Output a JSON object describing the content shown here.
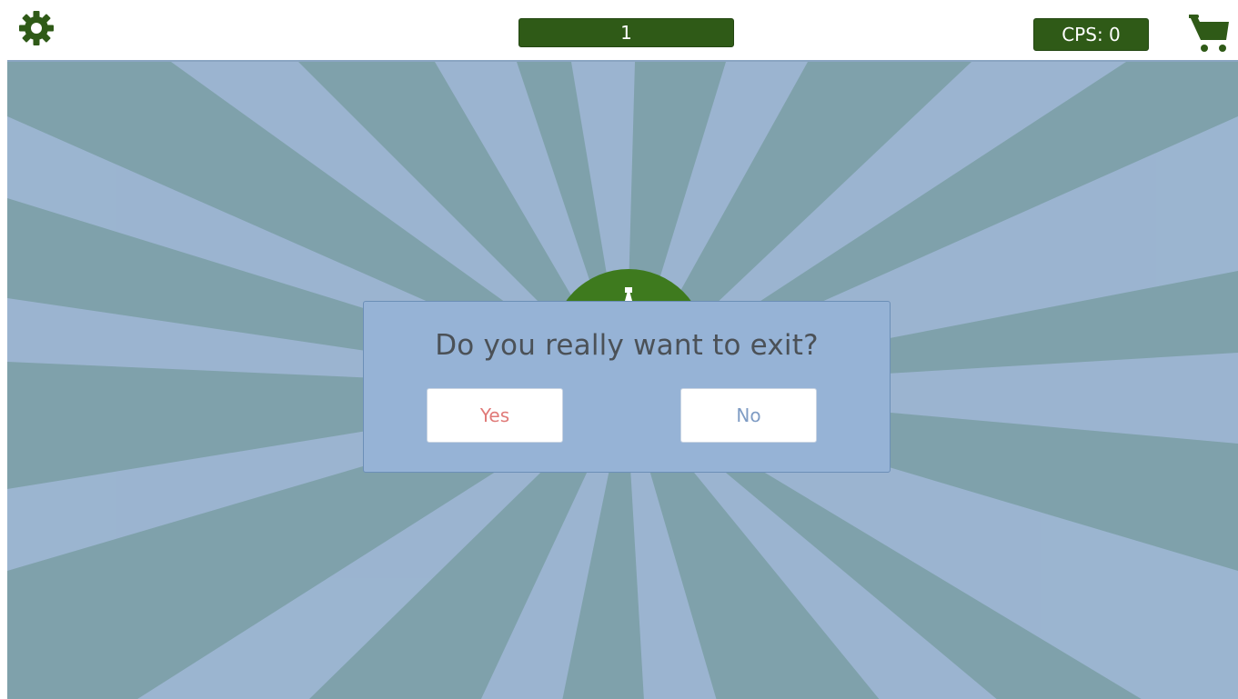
{
  "topbar": {
    "settings_icon": "gear-icon",
    "score": "1",
    "cps_label": "CPS: 0",
    "cart_icon": "cart-icon"
  },
  "game": {
    "clicker_icon": "letter-a-icon",
    "colors": {
      "ray_dark": "#7fa1ab",
      "ray_light": "#9db6d2",
      "accent_green": "#2f5a17",
      "clicker_green": "#3e7a1e"
    }
  },
  "dialog": {
    "title": "Do you really want to exit?",
    "yes_label": "Yes",
    "no_label": "No",
    "colors": {
      "background": "#96b3d6",
      "yes_text": "#e07a78",
      "no_text": "#7f9cc4"
    }
  }
}
